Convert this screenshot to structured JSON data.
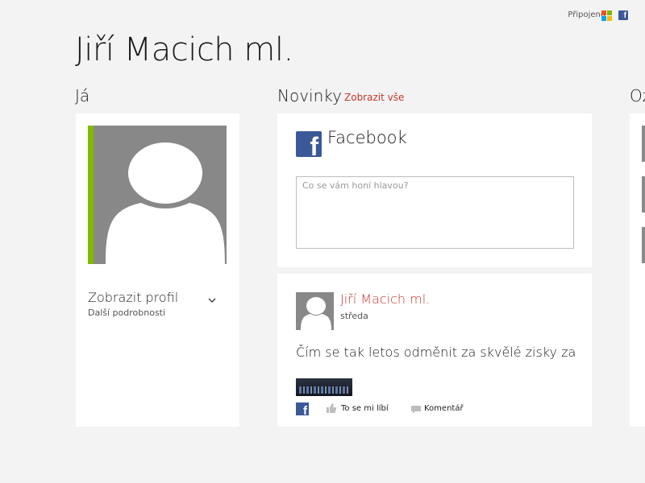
{
  "status": {
    "connected_label": "Připojeno",
    "microsoft_icon": "microsoft-icon",
    "facebook_icon": "facebook-icon"
  },
  "header": {
    "title": "Jiří Macich ml."
  },
  "me": {
    "heading": "Já",
    "avatar_icon": "person-silhouette-icon",
    "accent_color": "#7fba00",
    "view_profile": "Zobrazit profil",
    "more_details": "Další podrobnosti"
  },
  "news": {
    "heading": "Novinky",
    "see_all": "Zobrazit vše",
    "composer": {
      "network": "Facebook",
      "placeholder": "Co se vám honí hlavou?",
      "value": ""
    },
    "post": {
      "author": "Jiří Macich ml.",
      "day": "středa",
      "text": "Čím se tak letos odměnit za skvělé zisky za",
      "like_label": "To se mi líbí",
      "comment_label": "Komentář"
    }
  },
  "notifications": {
    "heading": "Oz"
  },
  "colors": {
    "accent": "#c8372d",
    "facebook": "#3b5998",
    "background": "#f3f3f3"
  }
}
